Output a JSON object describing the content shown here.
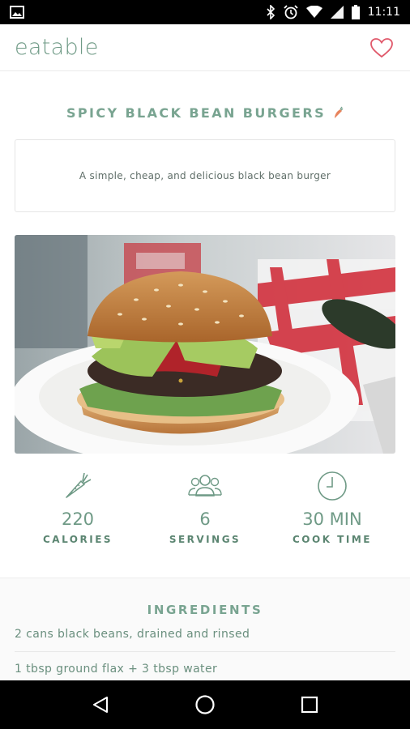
{
  "status_bar": {
    "time": "11:11",
    "icons": [
      "image-icon",
      "bluetooth-icon",
      "alarm-icon",
      "wifi-icon",
      "signal-icon",
      "battery-icon"
    ]
  },
  "app_bar": {
    "title": "eatable",
    "favorite_icon": "heart-icon"
  },
  "recipe": {
    "title": "SPICY BLACK BEAN BURGERS",
    "title_icon": "chili-pepper-icon",
    "description": "A simple, cheap, and delicious black bean burger",
    "image": "burger-photo"
  },
  "stats": [
    {
      "icon": "carrot-icon",
      "value": "220",
      "label": "CALORIES"
    },
    {
      "icon": "people-icon",
      "value": "6",
      "label": "SERVINGS"
    },
    {
      "icon": "clock-icon",
      "value": "30 MIN",
      "label": "COOK TIME"
    }
  ],
  "ingredients": {
    "heading": "INGREDIENTS",
    "items": [
      "2 cans black beans, drained and rinsed",
      "1 tbsp ground flax + 3 tbsp water"
    ]
  },
  "nav_bar": {
    "buttons": [
      "back-icon",
      "home-icon",
      "recents-icon"
    ]
  },
  "colors": {
    "accent": "#6f9a86",
    "heart": "#e0596b",
    "chili": "#e8845d"
  }
}
